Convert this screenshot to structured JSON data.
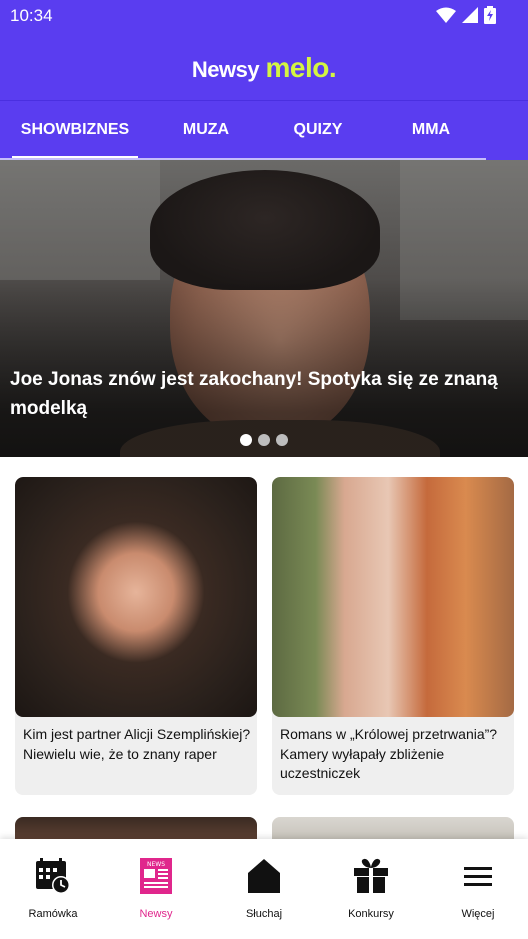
{
  "status": {
    "time": "10:34"
  },
  "header": {
    "logo_part1": "Newsy",
    "logo_part2": "melo."
  },
  "tabs": [
    {
      "label": "SHOWBIZNES",
      "active": true
    },
    {
      "label": "MUZA",
      "active": false
    },
    {
      "label": "QUIZY",
      "active": false
    },
    {
      "label": "MMA",
      "active": false
    }
  ],
  "hero": {
    "title": "Joe Jonas znów jest zakochany! Spotyka się ze znaną modelką",
    "slide_count": 3,
    "active_slide": 1
  },
  "cards": [
    {
      "title": "Kim jest partner Alicji Szemplińskiej? Niewielu wie, że to znany raper"
    },
    {
      "title": "Romans w „Królowej przetrwania”? Kamery wyłapały zbliżenie uczestniczek"
    }
  ],
  "bottom_nav": [
    {
      "label": "Ramówka",
      "icon": "schedule-calendar-icon",
      "active": false
    },
    {
      "label": "Newsy",
      "icon": "news-icon",
      "active": true
    },
    {
      "label": "Słuchaj",
      "icon": "home-icon",
      "active": false
    },
    {
      "label": "Konkursy",
      "icon": "gift-icon",
      "active": false
    },
    {
      "label": "Więcej",
      "icon": "menu-icon",
      "active": false
    }
  ],
  "colors": {
    "brand": "#5a3df0",
    "accent": "#d4f542",
    "active_nav": "#e0268c"
  }
}
